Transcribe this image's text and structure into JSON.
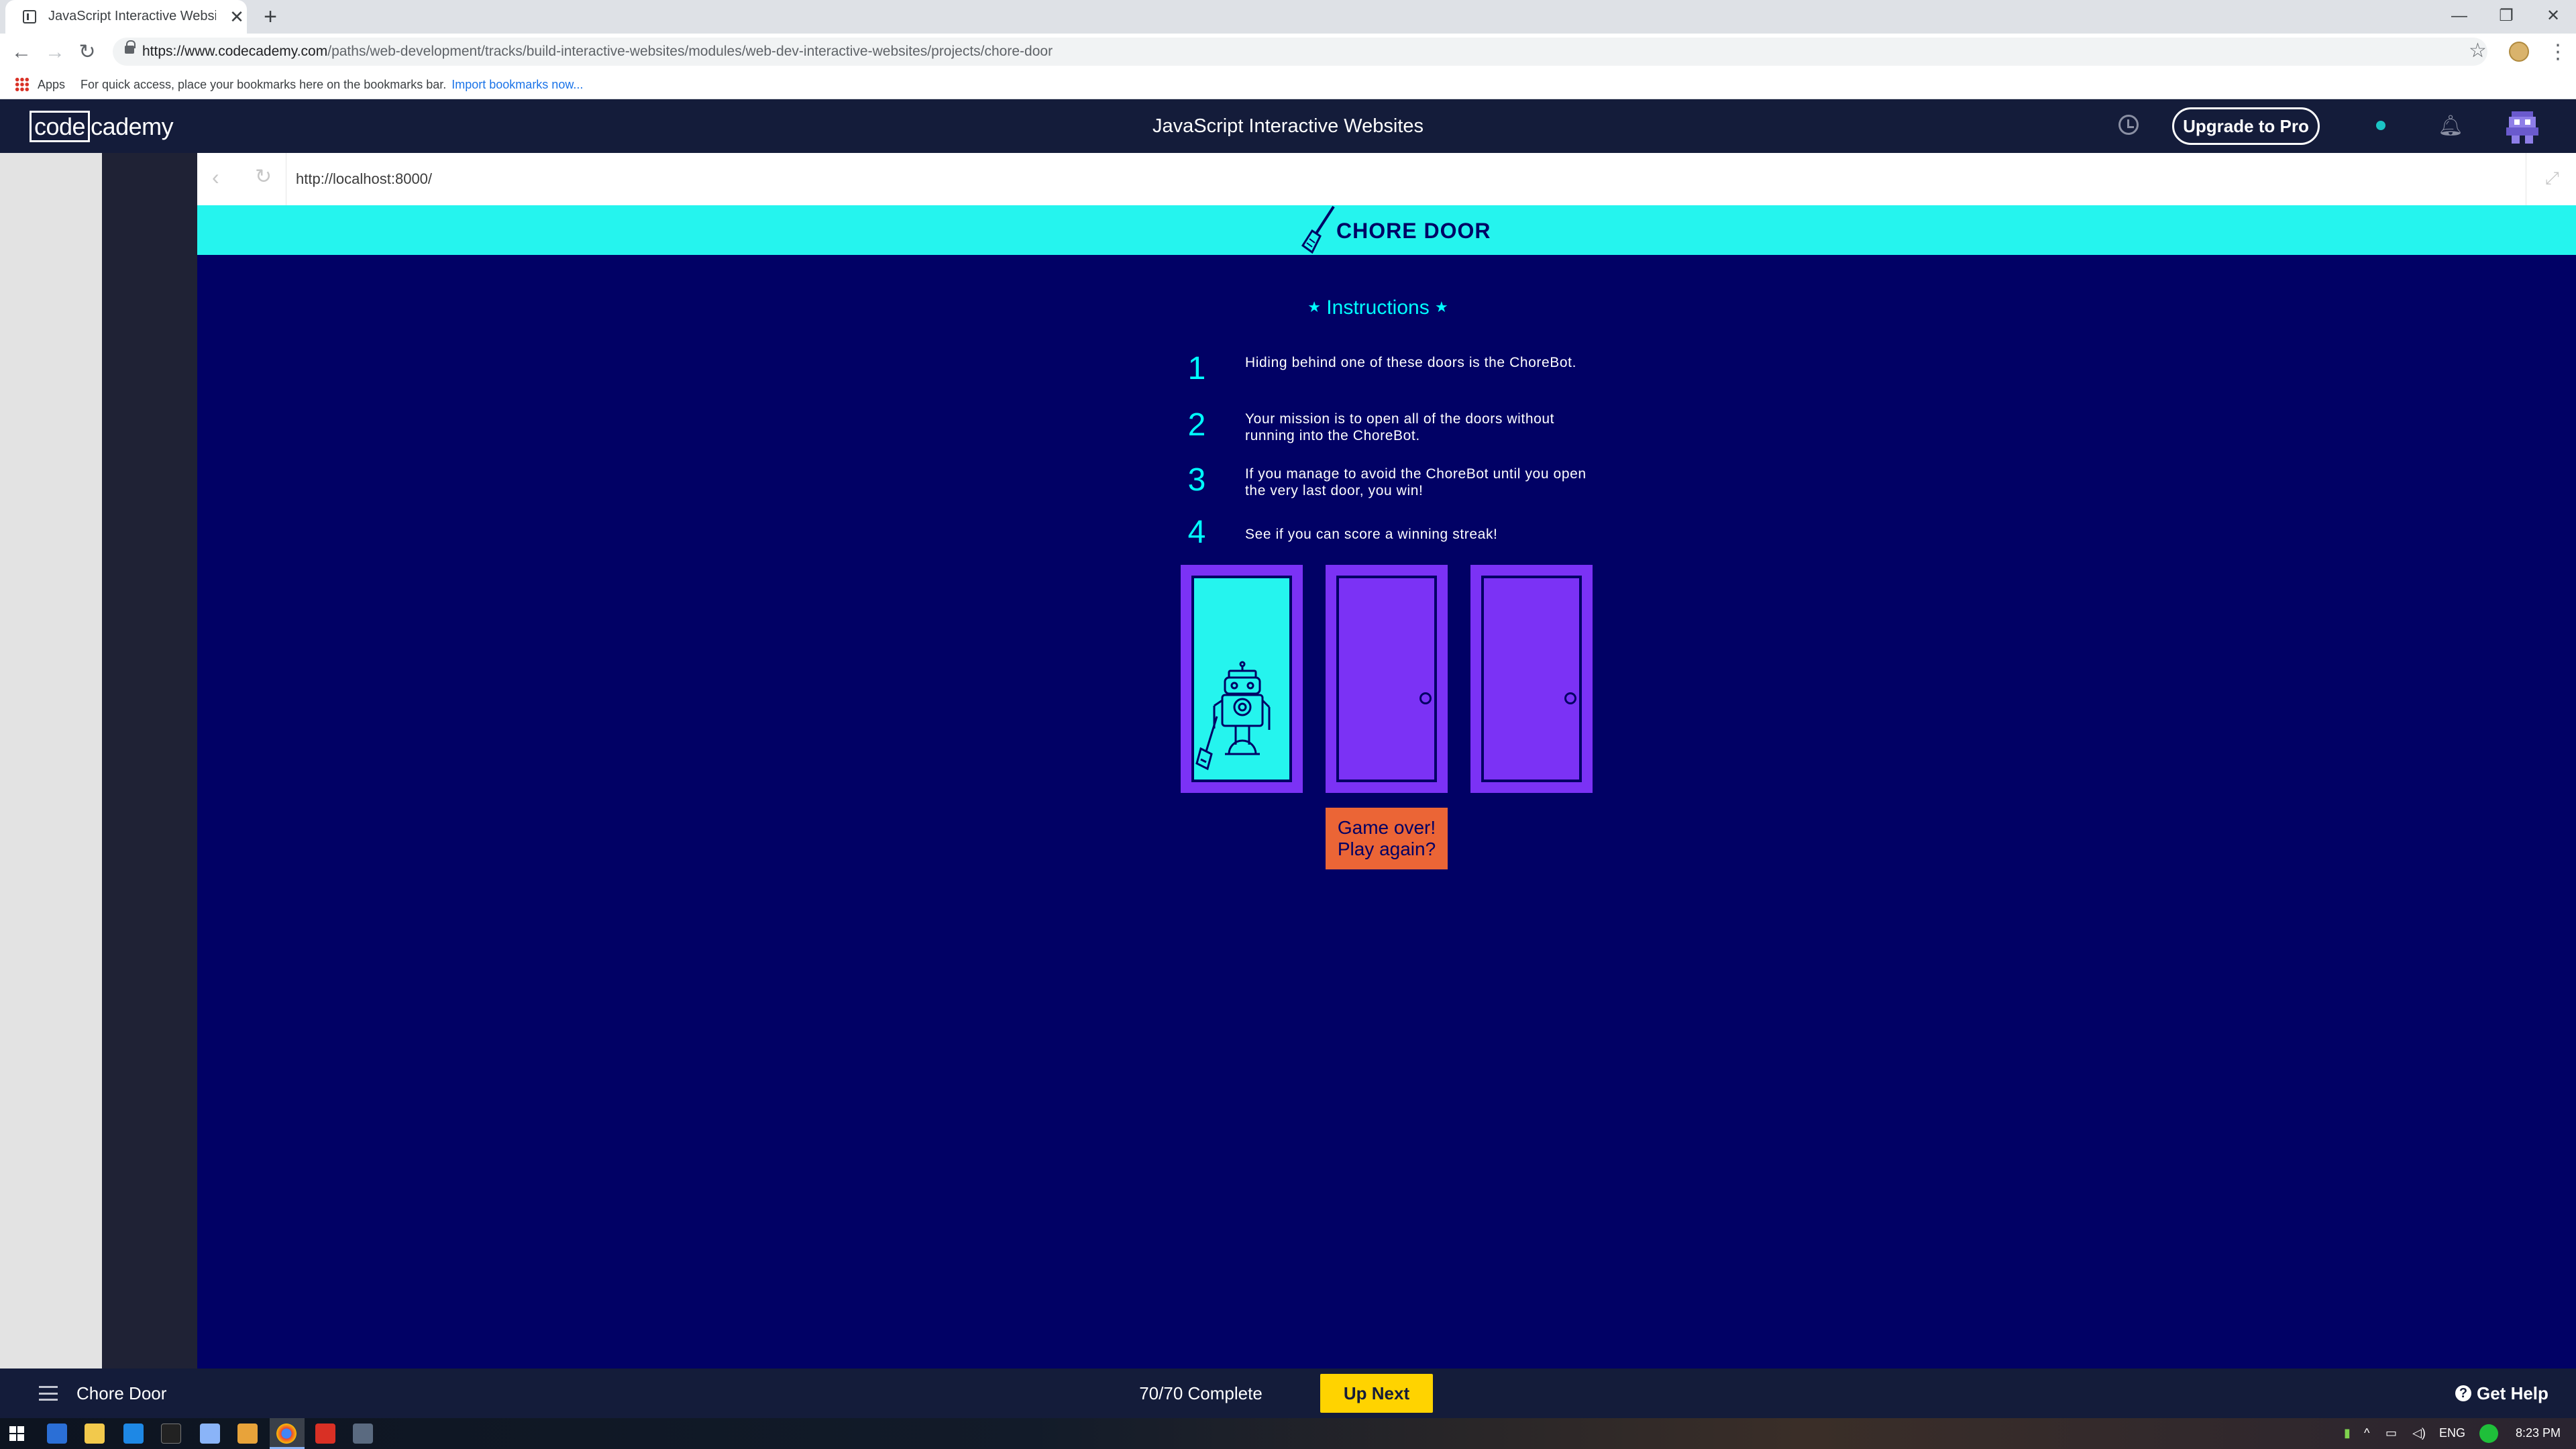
{
  "browser": {
    "tab_title": "JavaScript Interactive Websites | Codecademy",
    "new_tab_symbol": "+",
    "close_symbol": "✕",
    "window_controls": {
      "minimize": "—",
      "restore": "❐",
      "close": "✕"
    },
    "url_host": "https://www.codecademy.com",
    "url_path": "/paths/web-development/tracks/build-interactive-websites/modules/web-dev-interactive-websites/projects/chore-door",
    "bookmarks_apps_label": "Apps",
    "bookmarks_hint": "For quick access, place your bookmarks here on the bookmarks bar.",
    "bookmarks_import_link": "Import bookmarks now..."
  },
  "header": {
    "logo_code": "code",
    "logo_rest": "cademy",
    "course_title": "JavaScript Interactive Websites",
    "upgrade_label": "Upgrade to Pro"
  },
  "browser_panel": {
    "url": "http://localhost:8000/"
  },
  "game": {
    "title": "CHORE DOOR",
    "instructions_title": "Instructions",
    "star": "★",
    "steps": [
      {
        "number": "1",
        "text": "Hiding behind one of these doors is the ChoreBot."
      },
      {
        "number": "2",
        "text": "Your mission is to open all of the doors without running into the ChoreBot."
      },
      {
        "number": "3",
        "text": "If you manage to avoid the ChoreBot until you open the very last door, you win!"
      },
      {
        "number": "4",
        "text": "See if you can score a winning streak!"
      }
    ],
    "doors": [
      {
        "state": "open",
        "content": "robot"
      },
      {
        "state": "closed"
      },
      {
        "state": "closed"
      }
    ],
    "start_button_line1": "Game over!",
    "start_button_line2": "Play again?"
  },
  "footer": {
    "lesson_name": "Chore Door",
    "progress": "70/70 Complete",
    "up_next_label": "Up Next",
    "help_label": "Get Help",
    "help_icon_symbol": "?"
  },
  "taskbar": {
    "language": "ENG",
    "time": "8:23 PM"
  },
  "colors": {
    "game_background": "#010165",
    "game_header": "#25f4ee",
    "door": "#7b32f5",
    "start_button": "#eb6536",
    "up_next": "#ffd300",
    "cc_navy": "#141c3a"
  }
}
